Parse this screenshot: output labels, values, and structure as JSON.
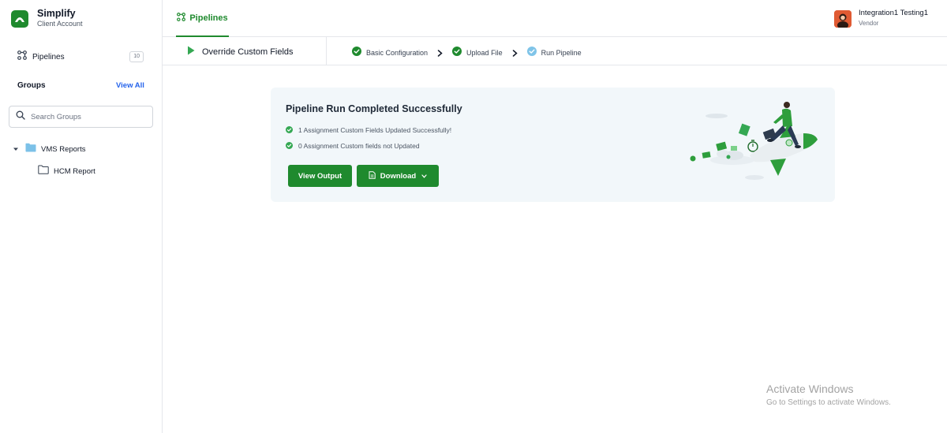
{
  "app": {
    "name": "Simplify",
    "subtitle": "Client Account"
  },
  "sidebar": {
    "pipelines_label": "Pipelines",
    "pipelines_count": "10",
    "groups_heading": "Groups",
    "view_all_label": "View All",
    "search_placeholder": "Search Groups",
    "tree": [
      {
        "label": "VMS Reports",
        "expanded": true,
        "icon": "folder-filled-icon"
      },
      {
        "label": "HCM Report",
        "icon": "folder-outline-icon"
      }
    ]
  },
  "topbar": {
    "active_tab": "Pipelines",
    "user": {
      "name": "Integration1 Testing1",
      "role": "Vendor"
    }
  },
  "subbar": {
    "title": "Override Custom Fields",
    "steps": [
      {
        "label": "Basic Configuration",
        "status": "done"
      },
      {
        "label": "Upload File",
        "status": "done"
      },
      {
        "label": "Run Pipeline",
        "status": "current"
      }
    ]
  },
  "result_card": {
    "title": "Pipeline Run Completed Successfully",
    "messages": [
      "1 Assignment Custom Fields Updated Successfully!",
      "0 Assignment Custom fields not Updated"
    ],
    "view_output_label": "View Output",
    "download_label": "Download"
  },
  "watermark": {
    "title": "Activate Windows",
    "subtitle": "Go to Settings to activate Windows."
  },
  "colors": {
    "brand_green": "#1f8a2e",
    "success_green": "#35a853",
    "current_step": "#7fc4e8",
    "link_blue": "#2563eb",
    "card_bg": "#f2f7fa",
    "folder_blue": "#7cc1e8"
  }
}
